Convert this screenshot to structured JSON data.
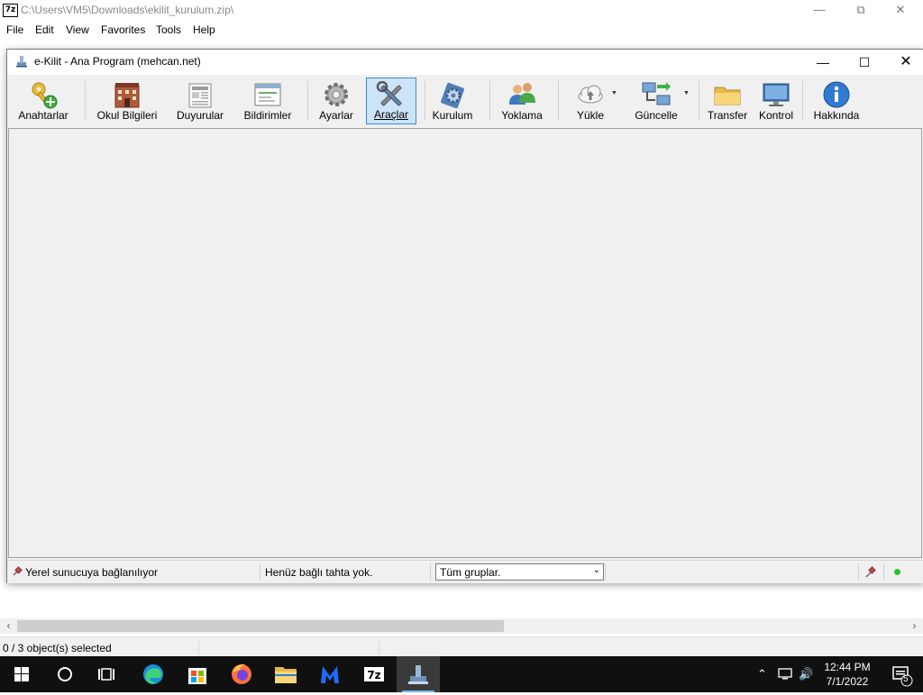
{
  "background_window": {
    "app_icon_text": "7z",
    "title": "C:\\Users\\VM5\\Downloads\\ekilit_kurulum.zip\\",
    "menu": [
      "File",
      "Edit",
      "View",
      "Favorites",
      "Tools",
      "Help"
    ],
    "status_text": "0 / 3 object(s) selected"
  },
  "main_window": {
    "title": "e-Kilit - Ana Program (mehcan.net)",
    "toolbar": [
      {
        "label": "Anahtarlar",
        "icon": "key-add-icon"
      },
      {
        "label": "Okul Bilgileri",
        "icon": "school-building-icon"
      },
      {
        "label": "Duyurular",
        "icon": "newspaper-icon"
      },
      {
        "label": "Bildirimler",
        "icon": "notification-window-icon"
      },
      {
        "label": "Ayarlar",
        "icon": "gear-icon"
      },
      {
        "label": "Araçlar",
        "icon": "tools-icon",
        "active": true
      },
      {
        "label": "Kurulum",
        "icon": "setup-gear-icon"
      },
      {
        "label": "Yoklama",
        "icon": "people-icon"
      },
      {
        "label": "Yükle",
        "icon": "cloud-upload-icon",
        "dropdown": true
      },
      {
        "label": "Güncelle",
        "icon": "network-update-icon",
        "dropdown": true
      },
      {
        "label": "Transfer",
        "icon": "folder-icon"
      },
      {
        "label": "Kontrol",
        "icon": "monitor-icon"
      },
      {
        "label": "Hakkında",
        "icon": "info-icon"
      }
    ],
    "status": {
      "connection_text": "Yerel sunucuya bağlanılıyor",
      "board_text": "Henüz bağlı tahta yok.",
      "group_filter": "Tüm gruplar."
    }
  },
  "taskbar": {
    "time": "12:44 PM",
    "date": "7/1/2022",
    "notification_count": "5",
    "apps": [
      "start-icon",
      "search-icon",
      "task-view-icon",
      "edge-icon",
      "store-icon",
      "firefox-icon",
      "file-explorer-icon",
      "malwarebytes-icon",
      "7zip-icon",
      "ekilit-icon"
    ]
  },
  "colors": {
    "active_button_fill": "#cce4f7",
    "active_button_border": "#3c8ad8",
    "taskbar": "#101010",
    "status_dot": "#2ec12e"
  }
}
